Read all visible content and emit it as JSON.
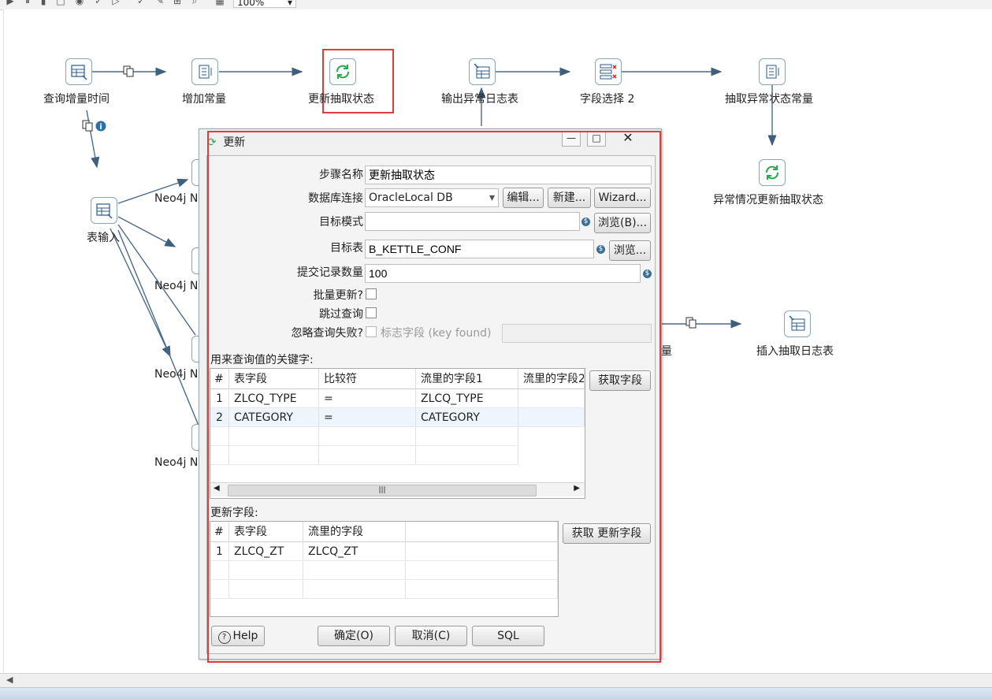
{
  "toolbar": {
    "zoom": "100%"
  },
  "canvas": {
    "steps": [
      {
        "id": "s1",
        "label": "查询增量时间",
        "icon": "table-input-icon"
      },
      {
        "id": "s2",
        "label": "增加常量",
        "icon": "add-constants-icon"
      },
      {
        "id": "s3",
        "label": "更新抽取状态",
        "icon": "update-icon"
      },
      {
        "id": "s4",
        "label": "输出异常日志表",
        "icon": "table-output-icon"
      },
      {
        "id": "s5",
        "label": "字段选择 2",
        "icon": "select-values-icon"
      },
      {
        "id": "s6",
        "label": "抽取异常状态常量",
        "icon": "add-constants-icon"
      },
      {
        "id": "s7",
        "label": "异常情况更新抽取状态",
        "icon": "update-icon"
      },
      {
        "id": "s8",
        "label": "表输入",
        "icon": "table-input-icon"
      },
      {
        "id": "s9",
        "label": "插入抽取日志表",
        "icon": "table-output-icon"
      },
      {
        "id": "s10",
        "label": "Neo4j N",
        "icon": "neo4j-icon"
      },
      {
        "id": "s11",
        "label": "Neo4j N",
        "icon": "neo4j-icon"
      },
      {
        "id": "s12",
        "label": "Neo4j N",
        "icon": "neo4j-icon"
      },
      {
        "id": "s13",
        "label": "Neo4j N",
        "icon": "neo4j-icon"
      },
      {
        "id": "s14",
        "label": "量",
        "icon": ""
      }
    ]
  },
  "dialog": {
    "title": "更新",
    "fields": {
      "step_name_label": "步骤名称",
      "step_name_value": "更新抽取状态",
      "db_conn_label": "数据库连接",
      "db_conn_value": "OracleLocal DB",
      "edit_btn": "编辑...",
      "new_btn": "新建...",
      "wizard_btn": "Wizard...",
      "target_schema_label": "目标模式",
      "target_schema_value": "",
      "browse_b_btn": "浏览(B)...",
      "target_table_label": "目标表",
      "target_table_value": "B_KETTLE_CONF",
      "browse_btn": "浏览...",
      "commit_size_label": "提交记录数量",
      "commit_size_value": "100",
      "batch_update_label": "批量更新?",
      "skip_lookup_label": "跳过查询",
      "ignore_fail_label": "忽略查询失败?",
      "flag_field_label": "标志字段 (key found)",
      "flag_field_value": ""
    },
    "keys_section": {
      "label": "用来查询值的关键字:",
      "get_fields_btn": "获取字段",
      "headers": [
        "#",
        "表字段",
        "比较符",
        "流里的字段1",
        "流里的字段2"
      ],
      "rows": [
        [
          "1",
          "ZLCQ_TYPE",
          "=",
          "ZLCQ_TYPE",
          ""
        ],
        [
          "2",
          "CATEGORY",
          "=",
          "CATEGORY",
          ""
        ]
      ]
    },
    "update_section": {
      "label": "更新字段:",
      "get_update_btn": "获取 更新字段",
      "headers": [
        "#",
        "表字段",
        "流里的字段"
      ],
      "rows": [
        [
          "1",
          "ZLCQ_ZT",
          "ZLCQ_ZT"
        ]
      ]
    },
    "buttons": {
      "help": "Help",
      "ok": "确定(O)",
      "cancel": "取消(C)",
      "sql": "SQL"
    }
  }
}
